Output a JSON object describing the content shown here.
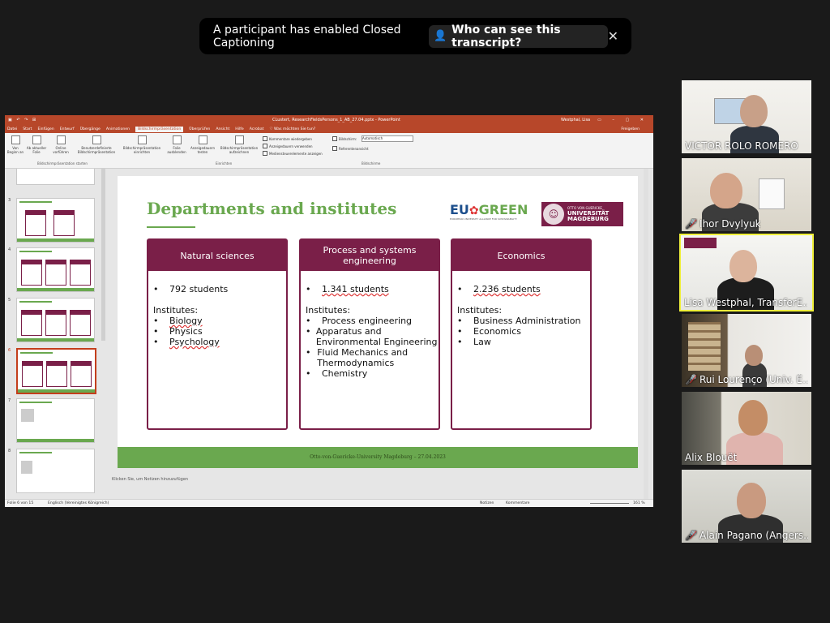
{
  "notification": {
    "message": "A participant has enabled Closed Captioning",
    "button": "Who can see this transcript?",
    "close": "✕"
  },
  "ppt": {
    "title": "CLustert, ResearchFieldsPersons_1_AB_27.04.pptx - PowerPoint",
    "user": "Westphal, Lisa",
    "tabs": [
      "Datei",
      "Start",
      "Einfügen",
      "Entwurf",
      "Übergänge",
      "Animationen",
      "Bildschirmpräsentation",
      "Überprüfen",
      "Ansicht",
      "Hilfe",
      "Acrobat",
      "♡ Was möchten Sie tun?"
    ],
    "active_tab": "Bildschirmpräsentation",
    "share": "Freigeben",
    "ribbon": {
      "buttons": [
        "Von Beginn an",
        "Ab aktueller Folie",
        "Online vorführen",
        "Benutzerdefinierte Bildschirmpräsentation",
        "Bildschirmpräsentation einrichten",
        "Folie ausblenden",
        "Anzeigedauern testen",
        "Bildschirmpräsentation aufzeichnen"
      ],
      "checks": [
        "Kommentare wiedergeben",
        "Anzeigedauern verwenden",
        "Medienstеuerelemente anzeigen",
        "Referentenansicht"
      ],
      "monitor_label": "Bildschirm:",
      "monitor_value": "Automatisch",
      "groups": [
        "Bildschirmpräsentation starten",
        "Einrichten",
        "Bildschirme"
      ]
    },
    "thumb_numbers": [
      "3",
      "4",
      "5",
      "6",
      "7",
      "8"
    ],
    "notes_placeholder": "Klicken Sie, um Notizen hinzuzufügen",
    "status": {
      "slide": "Folie 6 von 15",
      "lang": "Englisch (Vereinigtes Königreich)",
      "notes": "Notizen",
      "comments": "Kommentare",
      "zoom": "161 %"
    }
  },
  "slide": {
    "title": "Departments and institutes",
    "logo_eu": "EU",
    "logo_green": "GREEN",
    "logo_eu_sub": "EUROPEAN UNIVERSITY ALLIANCE FOR SUSTAINABILITY",
    "logo_uni_top": "OTTO VON GUERICKE",
    "logo_uni_1": "UNIVERSITÄT",
    "logo_uni_2": "MAGDEBURG",
    "footer": "Otto-von-Guericke-University Magdeburg – 27.04.2023",
    "institutes_label": "Institutes:",
    "bullet": "•",
    "boxes": [
      {
        "title": "Natural sciences",
        "students": "792 students",
        "institutes": [
          "Biology",
          "Physics",
          "Psychology"
        ]
      },
      {
        "title": "Process and systems engineering",
        "students": "1.341 students",
        "institutes": [
          "Process engineering",
          "Apparatus and Environmental Engineering",
          "Fluid Mechanics and Thermodynamics",
          "Chemistry"
        ]
      },
      {
        "title": "Economics",
        "students": "2.236 students",
        "institutes": [
          "Business Administration",
          "Economics",
          "Law"
        ]
      }
    ]
  },
  "participants": [
    {
      "name": "VICTOR ROLO ROMERO",
      "muted": false
    },
    {
      "name": "Ihor Dvylyuk",
      "muted": true
    },
    {
      "name": "Lisa Westphal, TransferE...",
      "muted": false
    },
    {
      "name": "Rui Lourenço (Univ. É...",
      "muted": true
    },
    {
      "name": "Alix Blouët",
      "muted": false
    },
    {
      "name": "Alain Pagano (Angers...",
      "muted": true
    }
  ],
  "icons": {
    "mic_muted": "mic-muted-icon",
    "transcript": "person-shield-icon",
    "close": "close-icon"
  }
}
